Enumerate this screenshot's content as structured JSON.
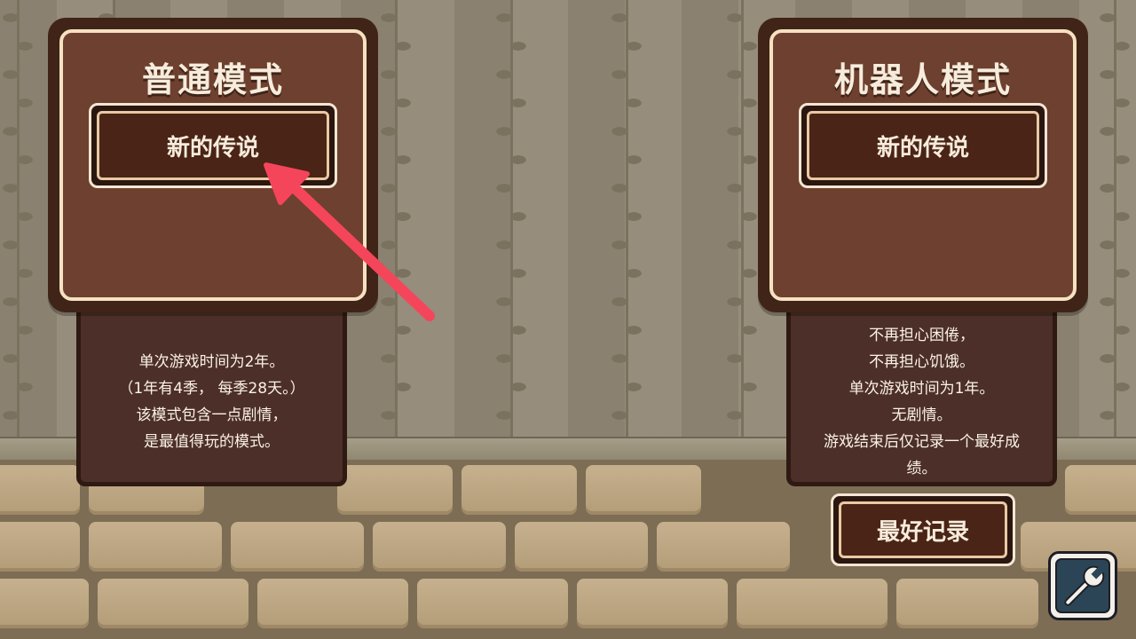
{
  "modes": [
    {
      "title": "普通模式",
      "start_label": "新的传说",
      "description": [
        "单次游戏时间为2年。",
        "（1年有4季， 每季28天。）",
        "该模式包含一点剧情，",
        "是最值得玩的模式。"
      ]
    },
    {
      "title": "机器人模式",
      "start_label": "新的传说",
      "description": [
        "不再担心困倦，",
        "不再担心饥饿。",
        "单次游戏时间为1年。",
        "无剧情。",
        "游戏结束后仅记录一个最好成",
        "绩。"
      ],
      "record_label": "最好记录"
    }
  ],
  "icons": {
    "settings": "wrench-icon",
    "pointer": "red-arrow-icon"
  },
  "colors": {
    "arrow": "#f5455a",
    "card": "#6e4030",
    "card_border": "#f6e1c0"
  }
}
